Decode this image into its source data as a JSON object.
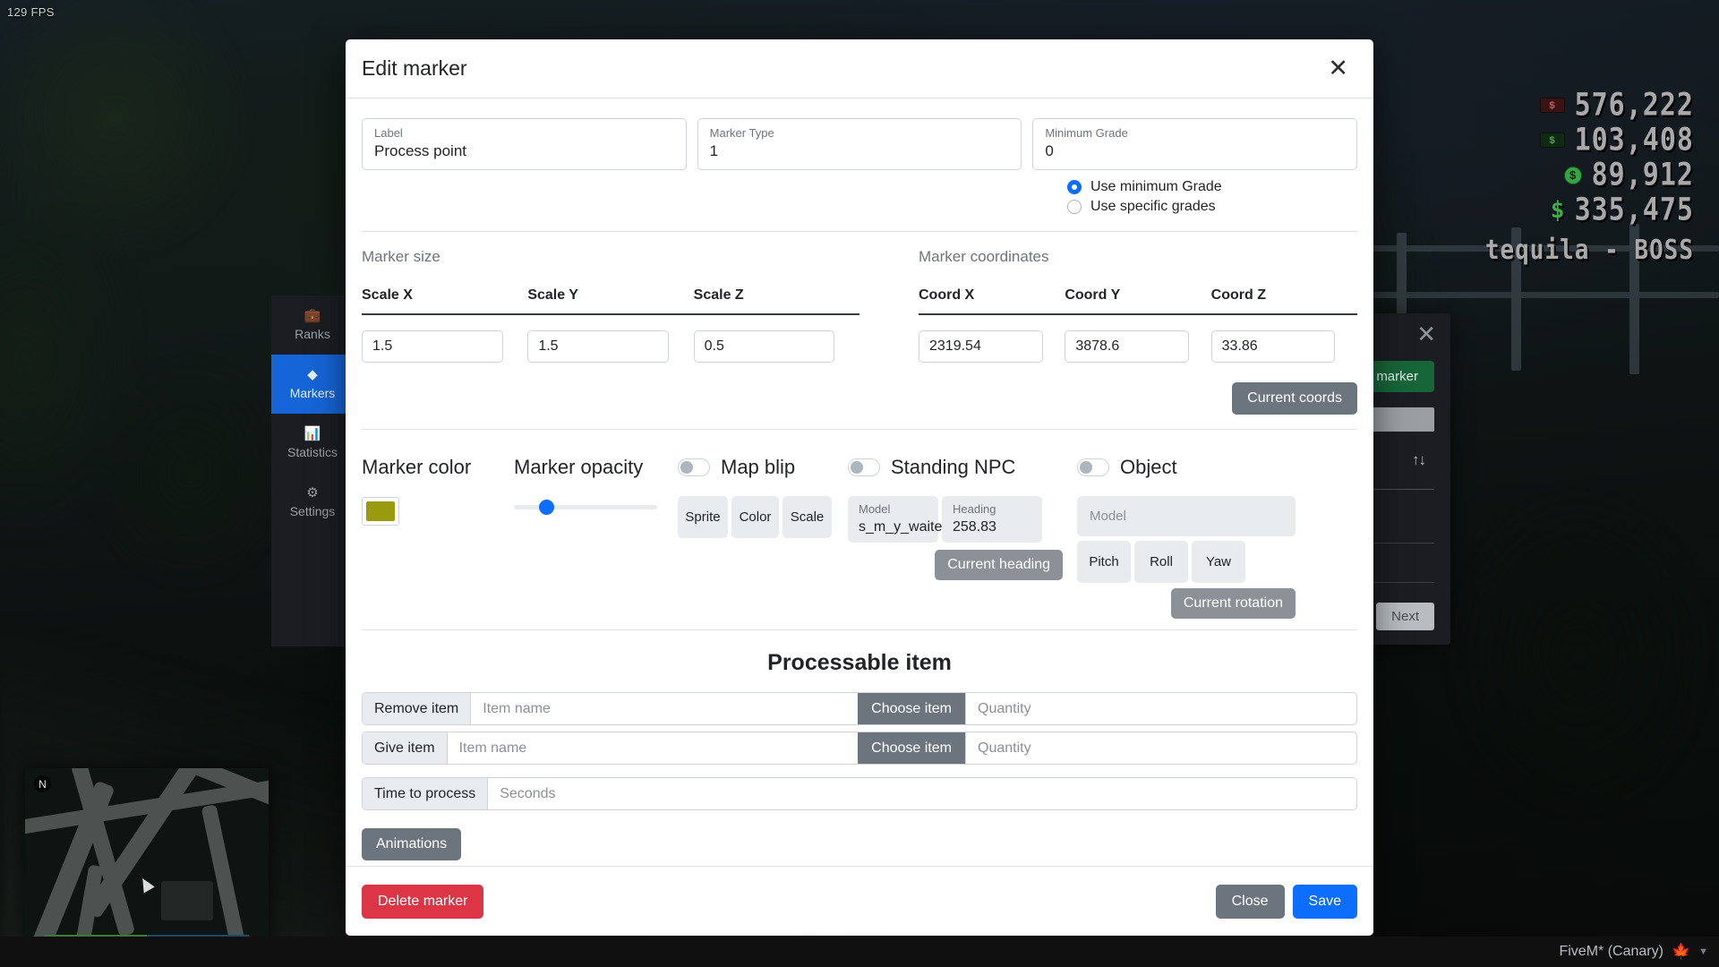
{
  "game": {
    "fps": "129 FPS",
    "hud": {
      "rows": [
        {
          "icon": "cash-bill-red-icon",
          "value": "576,222"
        },
        {
          "icon": "cash-bill-green-icon",
          "value": "103,408"
        },
        {
          "icon": "coin-icon",
          "value": "89,912"
        },
        {
          "icon": "dollar-sign-icon",
          "value": "335,475"
        }
      ],
      "job_name": "tequila - BOSS"
    },
    "minimap": {
      "compass": "N"
    },
    "taskbar": {
      "app_label": "FiveM* (Canary)",
      "leaf_icon": "maple-leaf-icon",
      "caret_icon": "chevron-down-icon"
    }
  },
  "sidebar": {
    "items": [
      {
        "icon": "briefcase-icon",
        "label": "Ranks",
        "active": false
      },
      {
        "icon": "diamond-icon",
        "label": "Markers",
        "active": true
      },
      {
        "icon": "bar-chart-icon",
        "label": "Statistics",
        "active": false
      },
      {
        "icon": "gear-icon",
        "label": "Settings",
        "active": false
      }
    ]
  },
  "marker_panel": {
    "close_icon": "close-icon",
    "new_marker_label": "New marker",
    "sort_icon": "sort-updown-icon",
    "next_label": "Next"
  },
  "modal": {
    "title": "Edit marker",
    "close_icon": "close-icon",
    "fields": {
      "label": {
        "label": "Label",
        "value": "Process point"
      },
      "marker_type": {
        "label": "Marker Type",
        "value": "1"
      },
      "minimum_grade": {
        "label": "Minimum Grade",
        "value": "0"
      }
    },
    "grade_mode": {
      "options": [
        {
          "label": "Use minimum Grade",
          "checked": true
        },
        {
          "label": "Use specific grades",
          "checked": false
        }
      ]
    },
    "marker_size": {
      "title": "Marker size",
      "headers": [
        "Scale X",
        "Scale Y",
        "Scale Z"
      ],
      "values": [
        "1.5",
        "1.5",
        "0.5"
      ]
    },
    "marker_coordinates": {
      "title": "Marker coordinates",
      "headers": [
        "Coord X",
        "Coord Y",
        "Coord Z"
      ],
      "values": [
        "2319.54",
        "3878.6",
        "33.86"
      ],
      "current_coords_label": "Current coords"
    },
    "marker_color": {
      "title": "Marker color",
      "swatch_hex": "#9a9a0f"
    },
    "marker_opacity": {
      "title": "Marker opacity",
      "value_percent": 20
    },
    "map_blip": {
      "title": "Map blip",
      "enabled": false,
      "buttons": [
        "Sprite",
        "Color",
        "Scale"
      ]
    },
    "standing_npc": {
      "title": "Standing NPC",
      "enabled": false,
      "model": {
        "label": "Model",
        "value": "s_m_y_waite"
      },
      "heading": {
        "label": "Heading",
        "value": "258.83"
      },
      "current_heading_label": "Current heading"
    },
    "object": {
      "title": "Object",
      "enabled": false,
      "model_placeholder": "Model",
      "rotation_buttons": [
        "Pitch",
        "Roll",
        "Yaw"
      ],
      "current_rotation_label": "Current rotation"
    },
    "processable": {
      "title": "Processable item",
      "remove_item": {
        "addon": "Remove item",
        "name_placeholder": "Item name",
        "choose_label": "Choose item",
        "quantity_placeholder": "Quantity"
      },
      "give_item": {
        "addon": "Give item",
        "name_placeholder": "Item name",
        "choose_label": "Choose item",
        "quantity_placeholder": "Quantity"
      },
      "time_to_process": {
        "addon": "Time to process",
        "placeholder": "Seconds"
      },
      "animations_label": "Animations"
    },
    "footer": {
      "delete_label": "Delete marker",
      "close_label": "Close",
      "save_label": "Save"
    }
  }
}
